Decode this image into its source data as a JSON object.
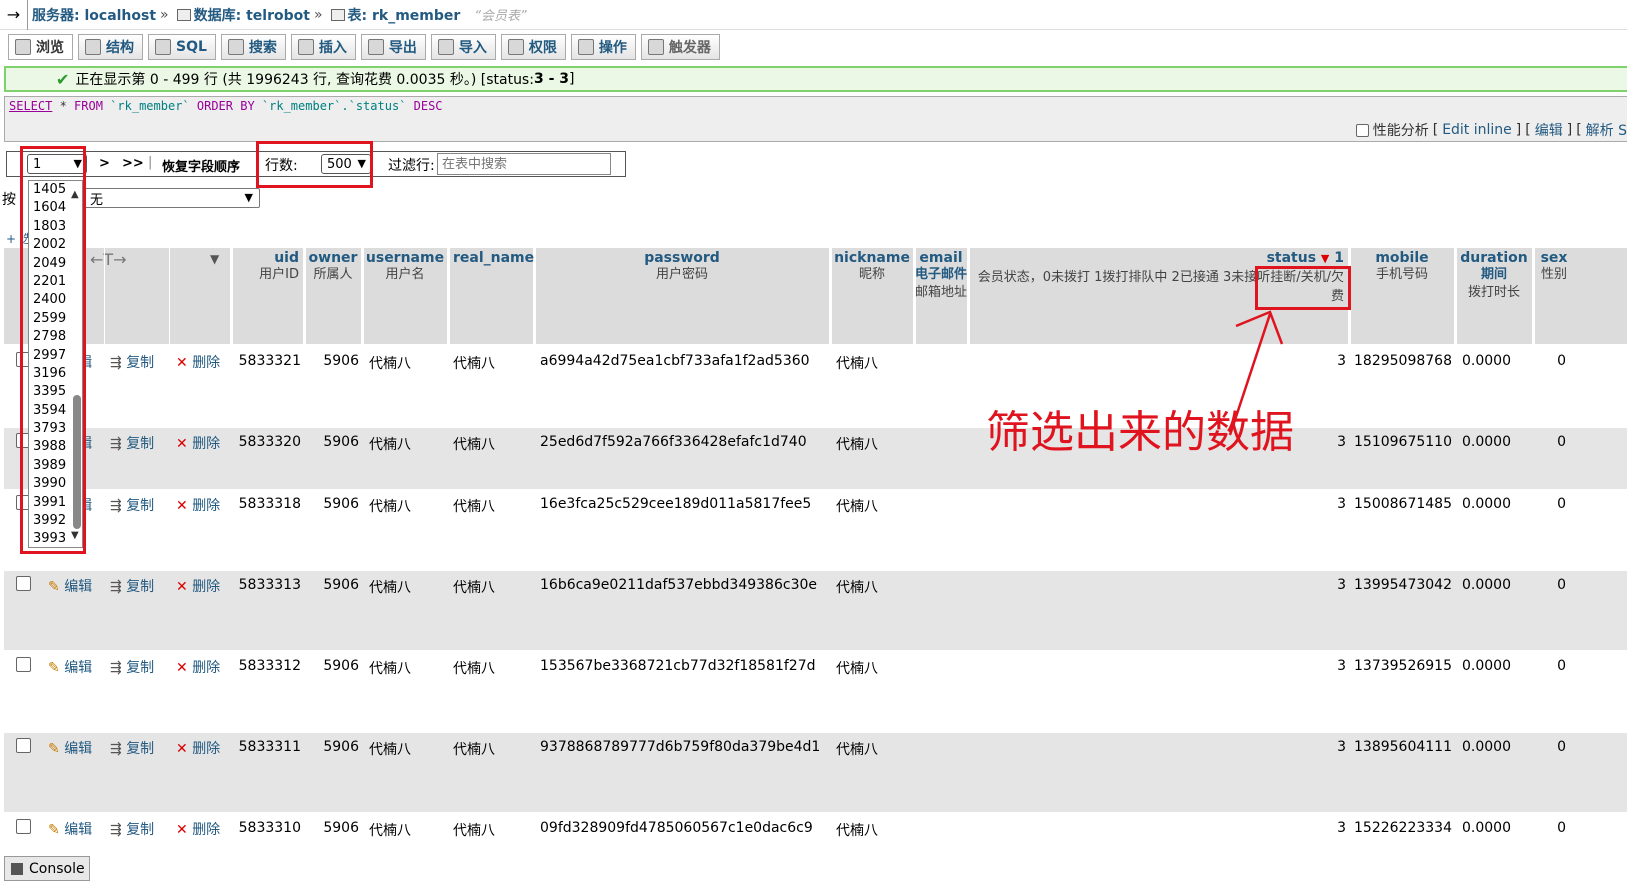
{
  "breadcrumb": {
    "server": "服务器: localhost",
    "database": "数据库: telrobot",
    "table": "表: rk_member",
    "comment": "“会员表”"
  },
  "tabs": [
    {
      "label": "浏览",
      "icon": "browse-icon"
    },
    {
      "label": "结构",
      "icon": "structure-icon"
    },
    {
      "label": "SQL",
      "icon": "sql-icon"
    },
    {
      "label": "搜索",
      "icon": "search-icon"
    },
    {
      "label": "插入",
      "icon": "insert-icon"
    },
    {
      "label": "导出",
      "icon": "export-icon"
    },
    {
      "label": "导入",
      "icon": "import-icon"
    },
    {
      "label": "权限",
      "icon": "privileges-icon"
    },
    {
      "label": "操作",
      "icon": "operations-icon"
    },
    {
      "label": "触发器",
      "icon": "triggers-icon"
    }
  ],
  "success": {
    "text": "正在显示第 0 - 499 行 (共 1996243 行, 查询花费 0.0035 秒。) [status: ",
    "range": "3 - 3",
    "end": "]"
  },
  "sql": {
    "select": "SELECT",
    "rest1": " * ",
    "from": "FROM",
    "table": " `rk_member` ",
    "order": "ORDER BY",
    "col": " `rk_member`.`status` ",
    "desc": "DESC"
  },
  "sqltools": {
    "profiling": "性能分析",
    "edit_inline": "Edit inline",
    "edit": "编辑",
    "explain": "解析 S"
  },
  "nav": {
    "page_value": "1",
    "next": ">",
    "last": ">>",
    "restore": "恢复字段顺序",
    "rows_label": "行数:",
    "rows_value": "500",
    "filter_label": "过滤行:",
    "filter_placeholder": "在表中搜索"
  },
  "sort": {
    "label": "按",
    "value": "无"
  },
  "options_link": "+ 选",
  "dropdown": [
    "1405",
    "1604",
    "1803",
    "2002",
    "2049",
    "2201",
    "2400",
    "2599",
    "2798",
    "2997",
    "3196",
    "3395",
    "3594",
    "3793",
    "3988",
    "3989",
    "3990",
    "3991",
    "3992",
    "3993"
  ],
  "annotation": "筛选出来的数据",
  "header_icons": {
    "arrows": "←T→"
  },
  "columns": [
    {
      "name": "uid",
      "comment": "用户ID"
    },
    {
      "name": "owner",
      "comment": "所属人"
    },
    {
      "name": "username",
      "comment": "用户名"
    },
    {
      "name": "real_name",
      "comment": ""
    },
    {
      "name": "password",
      "comment": "用户密码"
    },
    {
      "name": "nickname",
      "comment": "昵称"
    },
    {
      "name": "email",
      "comment": "电子邮件",
      "comment2": "邮箱地址"
    },
    {
      "name": "status",
      "sort": "1",
      "comment": "会员状态，0未拨打 1拨打排队中 2已接通 3未接听挂断/关机/欠费"
    },
    {
      "name": "mobile",
      "comment": "手机号码"
    },
    {
      "name": "duration",
      "comment": "期间",
      "comment2": "拨打时长"
    },
    {
      "name": "sex",
      "comment": "性别"
    }
  ],
  "actions": {
    "edit": "编辑",
    "copy": "复制",
    "delete": "删除"
  },
  "rows": [
    {
      "uid": "5833321",
      "owner": "5906",
      "username": "代楠八",
      "real_name": "代楠八",
      "password": "a6994a42d75ea1cbf733afa1f2ad5360",
      "nickname": "代楠八",
      "status": "3",
      "mobile": "18295098768",
      "duration": "0.0000",
      "sex": "0"
    },
    {
      "uid": "5833320",
      "owner": "5906",
      "username": "代楠八",
      "real_name": "代楠八",
      "password": "25ed6d7f592a766f336428efafc1d740",
      "nickname": "代楠八",
      "status": "3",
      "mobile": "15109675110",
      "duration": "0.0000",
      "sex": "0"
    },
    {
      "uid": "5833318",
      "owner": "5906",
      "username": "代楠八",
      "real_name": "代楠八",
      "password": "16e3fca25c529cee189d011a5817fee5",
      "nickname": "代楠八",
      "status": "3",
      "mobile": "15008671485",
      "duration": "0.0000",
      "sex": "0"
    },
    {
      "uid": "5833313",
      "owner": "5906",
      "username": "代楠八",
      "real_name": "代楠八",
      "password": "16b6ca9e0211daf537ebbd349386c30e",
      "nickname": "代楠八",
      "status": "3",
      "mobile": "13995473042",
      "duration": "0.0000",
      "sex": "0"
    },
    {
      "uid": "5833312",
      "owner": "5906",
      "username": "代楠八",
      "real_name": "代楠八",
      "password": "153567be3368721cb77d32f18581f27d",
      "nickname": "代楠八",
      "status": "3",
      "mobile": "13739526915",
      "duration": "0.0000",
      "sex": "0"
    },
    {
      "uid": "5833311",
      "owner": "5906",
      "username": "代楠八",
      "real_name": "代楠八",
      "password": "9378868789777d6b759f80da379be4d1",
      "nickname": "代楠八",
      "status": "3",
      "mobile": "13895604111",
      "duration": "0.0000",
      "sex": "0"
    },
    {
      "uid": "5833310",
      "owner": "5906",
      "username": "代楠八",
      "real_name": "代楠八",
      "password": "09fd328909fd4785060567c1e0dac6c9",
      "nickname": "代楠八",
      "status": "3",
      "mobile": "15226223334",
      "duration": "0.0000",
      "sex": "0"
    }
  ],
  "console": "Console"
}
